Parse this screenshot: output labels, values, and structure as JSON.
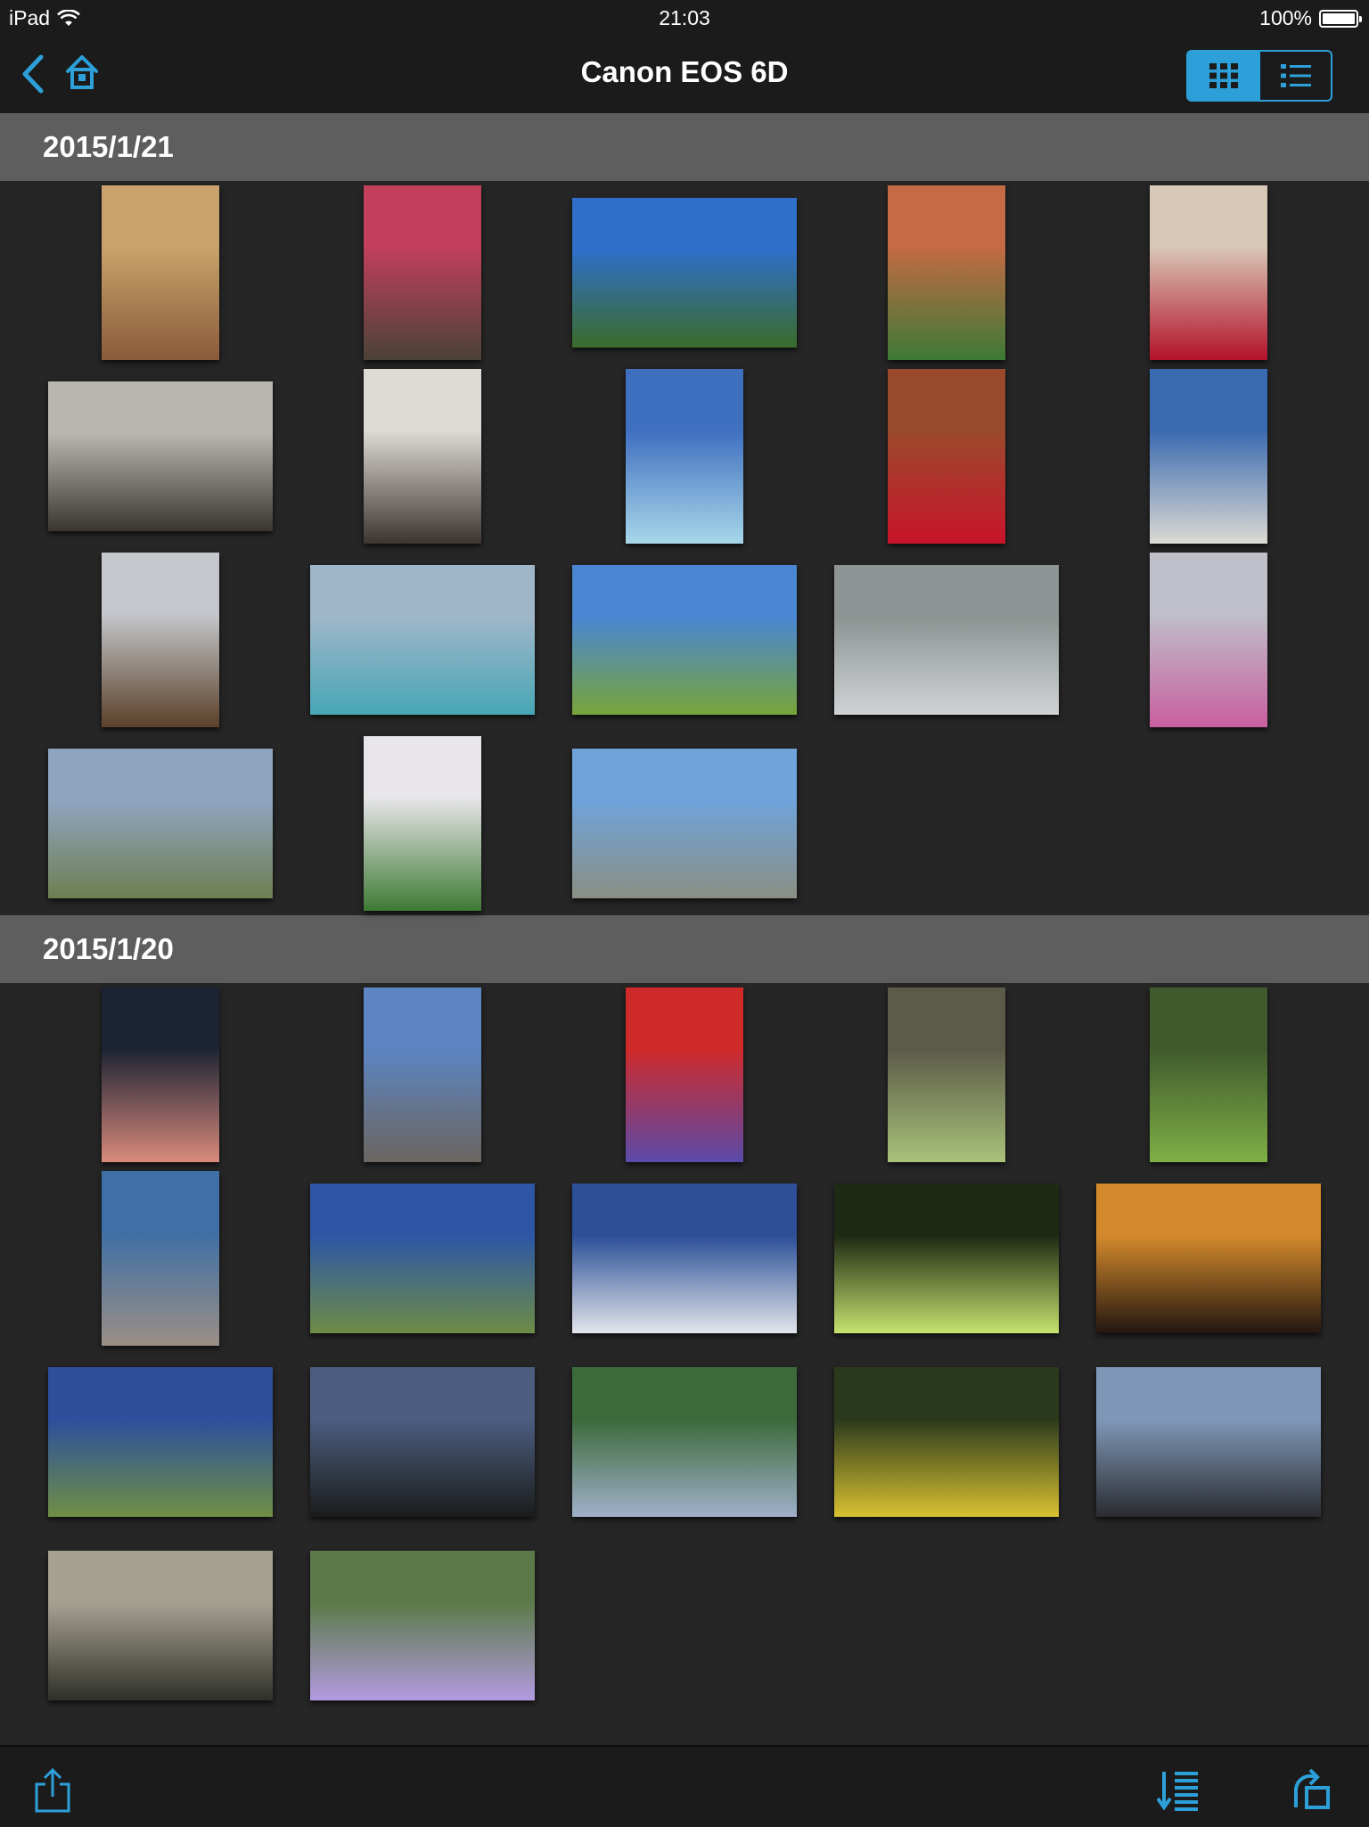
{
  "status_bar": {
    "device": "iPad",
    "time": "21:03",
    "battery": "100%"
  },
  "nav": {
    "title": "Canon EOS 6D",
    "back_icon": "chevron-left-icon",
    "home_icon": "home-icon",
    "view_grid_icon": "grid-view-icon",
    "view_list_icon": "list-view-icon",
    "active_view": "grid"
  },
  "accent_color": "#2da0d9",
  "sections": [
    {
      "date": "2015/1/21",
      "photos": [
        {
          "orientation": "portrait",
          "colors": [
            "#c9a36b",
            "#8a5b3a"
          ]
        },
        {
          "orientation": "portrait",
          "colors": [
            "#c2405c",
            "#4a4237"
          ]
        },
        {
          "orientation": "landscape",
          "colors": [
            "#2f6fc9",
            "#3b6b2a"
          ]
        },
        {
          "orientation": "portrait",
          "colors": [
            "#c46a44",
            "#3d7a36"
          ]
        },
        {
          "orientation": "portrait",
          "colors": [
            "#d8c8b6",
            "#b3122a"
          ]
        },
        {
          "orientation": "landscape",
          "colors": [
            "#b9b6b1",
            "#3a3530"
          ]
        },
        {
          "orientation": "portrait",
          "colors": [
            "#dedbd5",
            "#3d3430"
          ]
        },
        {
          "orientation": "portrait",
          "colors": [
            "#3f6fbf",
            "#a8d7ea"
          ]
        },
        {
          "orientation": "portrait",
          "colors": [
            "#9a4a2c",
            "#c8142a"
          ]
        },
        {
          "orientation": "portrait",
          "colors": [
            "#3a6ab0",
            "#dcdad3"
          ]
        },
        {
          "orientation": "portrait",
          "colors": [
            "#c4c7cb",
            "#5b4029"
          ]
        },
        {
          "orientation": "landscape",
          "colors": [
            "#9fb6c9",
            "#47a6b5"
          ]
        },
        {
          "orientation": "landscape",
          "colors": [
            "#4a86d2",
            "#78a43a"
          ]
        },
        {
          "orientation": "landscape",
          "colors": [
            "#8e9493",
            "#cfd3d5"
          ]
        },
        {
          "orientation": "portrait",
          "colors": [
            "#bfbfc9",
            "#c85fa0"
          ]
        },
        {
          "orientation": "landscape",
          "colors": [
            "#8fa4bf",
            "#6d7f51"
          ]
        },
        {
          "orientation": "portrait",
          "colors": [
            "#e8e6ea",
            "#3f7a35"
          ]
        },
        {
          "orientation": "landscape",
          "colors": [
            "#6fa3da",
            "#8a8f83"
          ]
        }
      ]
    },
    {
      "date": "2015/1/20",
      "photos": [
        {
          "orientation": "portrait",
          "colors": [
            "#1c2333",
            "#d98a7c"
          ]
        },
        {
          "orientation": "portrait",
          "colors": [
            "#5d85c2",
            "#6b6660"
          ]
        },
        {
          "orientation": "portrait",
          "colors": [
            "#cf2a2a",
            "#5a4aa8"
          ]
        },
        {
          "orientation": "portrait",
          "colors": [
            "#5c5a48",
            "#a8c27a"
          ]
        },
        {
          "orientation": "portrait",
          "colors": [
            "#3f5a2c",
            "#7fb046"
          ]
        },
        {
          "orientation": "portrait",
          "colors": [
            "#3e6fa5",
            "#9b8f85"
          ]
        },
        {
          "orientation": "landscape",
          "colors": [
            "#2d57a5",
            "#6e8c46"
          ]
        },
        {
          "orientation": "landscape",
          "colors": [
            "#2c4f98",
            "#e2e5ea"
          ]
        },
        {
          "orientation": "landscape",
          "colors": [
            "#1f2a14",
            "#c6e26e"
          ]
        },
        {
          "orientation": "landscape",
          "colors": [
            "#d48a2c",
            "#221610"
          ]
        },
        {
          "orientation": "landscape",
          "colors": [
            "#2d4f9c",
            "#6f8f45"
          ]
        },
        {
          "orientation": "landscape",
          "colors": [
            "#4c5d80",
            "#1a1c1a"
          ]
        },
        {
          "orientation": "landscape",
          "colors": [
            "#3d6a3a",
            "#9fb0c9"
          ]
        },
        {
          "orientation": "landscape",
          "colors": [
            "#2b3a1c",
            "#d8c131"
          ]
        },
        {
          "orientation": "landscape",
          "colors": [
            "#7f98b8",
            "#2a2c30"
          ]
        },
        {
          "orientation": "landscape",
          "colors": [
            "#a6a090",
            "#2e3029"
          ]
        },
        {
          "orientation": "landscape",
          "colors": [
            "#5b7a4a",
            "#b49be0"
          ]
        }
      ]
    }
  ],
  "toolbar": {
    "share_icon": "share-icon",
    "sort_icon": "sort-icon",
    "rotate_icon": "rotate-icon"
  }
}
